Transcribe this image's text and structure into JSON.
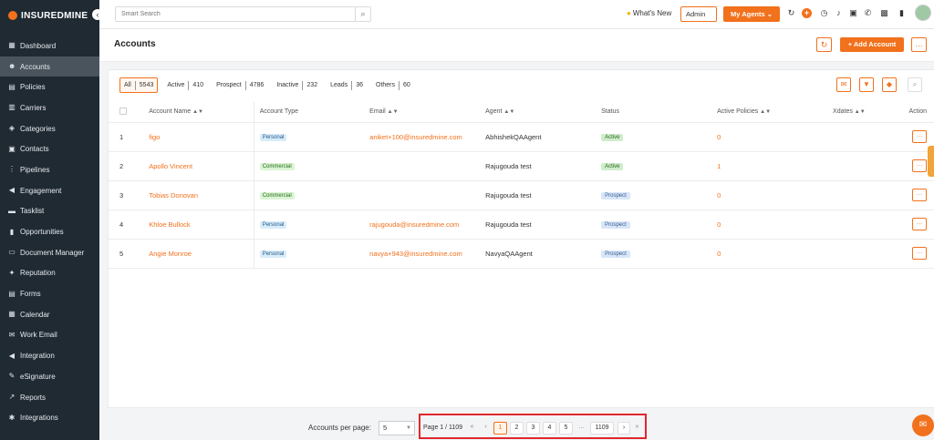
{
  "brand": {
    "name": "INSUREDMINE"
  },
  "sidebar": {
    "items": [
      {
        "label": "Dashboard",
        "icon": "dashboard-icon",
        "glyph": "▦"
      },
      {
        "label": "Accounts",
        "icon": "accounts-icon",
        "glyph": "☻",
        "active": true
      },
      {
        "label": "Policies",
        "icon": "policies-icon",
        "glyph": "▤"
      },
      {
        "label": "Carriers",
        "icon": "carriers-icon",
        "glyph": "▥"
      },
      {
        "label": "Categories",
        "icon": "categories-icon",
        "glyph": "◈"
      },
      {
        "label": "Contacts",
        "icon": "contacts-icon",
        "glyph": "▣"
      },
      {
        "label": "Pipelines",
        "icon": "pipelines-icon",
        "glyph": "⋮"
      },
      {
        "label": "Engagement",
        "icon": "engagement-icon",
        "glyph": "◀"
      },
      {
        "label": "Tasklist",
        "icon": "tasklist-icon",
        "glyph": "▬"
      },
      {
        "label": "Opportunities",
        "icon": "opportunities-icon",
        "glyph": "▮"
      },
      {
        "label": "Document Manager",
        "icon": "document-manager-icon",
        "glyph": "▭"
      },
      {
        "label": "Reputation",
        "icon": "reputation-icon",
        "glyph": "✦"
      },
      {
        "label": "Forms",
        "icon": "forms-icon",
        "glyph": "▤"
      },
      {
        "label": "Calendar",
        "icon": "calendar-icon",
        "glyph": "▦"
      },
      {
        "label": "Work Email",
        "icon": "work-email-icon",
        "glyph": "✉"
      },
      {
        "label": "Integration",
        "icon": "integration-icon",
        "glyph": "◀"
      },
      {
        "label": "eSignature",
        "icon": "esignature-icon",
        "glyph": "✎"
      },
      {
        "label": "Reports",
        "icon": "reports-icon",
        "glyph": "↗"
      },
      {
        "label": "Integrations",
        "icon": "integrations-icon",
        "glyph": "✱"
      }
    ]
  },
  "topbar": {
    "search_placeholder": "Smart Search",
    "whats_new": "What's New",
    "admin": "Admin",
    "my_agents": "My Agents ⌄"
  },
  "header": {
    "title": "Accounts",
    "add_account": "+ Add Account"
  },
  "filters": [
    {
      "label": "All",
      "count": "5543",
      "active": true
    },
    {
      "label": "Active",
      "count": "410"
    },
    {
      "label": "Prospect",
      "count": "4786"
    },
    {
      "label": "Inactive",
      "count": "232"
    },
    {
      "label": "Leads",
      "count": "36"
    },
    {
      "label": "Others",
      "count": "60"
    }
  ],
  "table": {
    "headers": {
      "name": "Account Name",
      "type": "Account Type",
      "email": "Email",
      "agent": "Agent",
      "status": "Status",
      "policies": "Active Policies",
      "xdates": "Xdates",
      "action": "Action"
    },
    "rows": [
      {
        "num": "1",
        "name": "figo",
        "type": "Personal",
        "email": "aniket+100@insuredmine.com",
        "agent": "AbhishekQAAgent",
        "status": "Active",
        "policies": "0"
      },
      {
        "num": "2",
        "name": "Apollo Vincent",
        "type": "Commercial",
        "email": "",
        "agent": "Rajugouda test",
        "status": "Active",
        "policies": "1"
      },
      {
        "num": "3",
        "name": "Tobias Donovan",
        "type": "Commercial",
        "email": "",
        "agent": "Rajugouda test",
        "status": "Prospect",
        "policies": "0"
      },
      {
        "num": "4",
        "name": "Khloe Bullock",
        "type": "Personal",
        "email": "rajugouda@insuredmine.com",
        "agent": "Rajugouda test",
        "status": "Prospect",
        "policies": "0"
      },
      {
        "num": "5",
        "name": "Angie Monroe",
        "type": "Personal",
        "email": "navya+943@insuredmine.com",
        "agent": "NavyaQAAgent",
        "status": "Prospect",
        "policies": "0"
      }
    ]
  },
  "footer": {
    "per_page_label": "Accounts per page:",
    "per_page_value": "5",
    "page_info": "Page 1 / 1109",
    "first": "«",
    "prev": "‹",
    "pages": [
      "1",
      "2",
      "3",
      "4",
      "5"
    ],
    "ellipsis": "...",
    "last_page": "1109",
    "next": "›",
    "last": "»"
  },
  "colors": {
    "accent": "#f2711c",
    "sidebar": "#1f2a33"
  }
}
